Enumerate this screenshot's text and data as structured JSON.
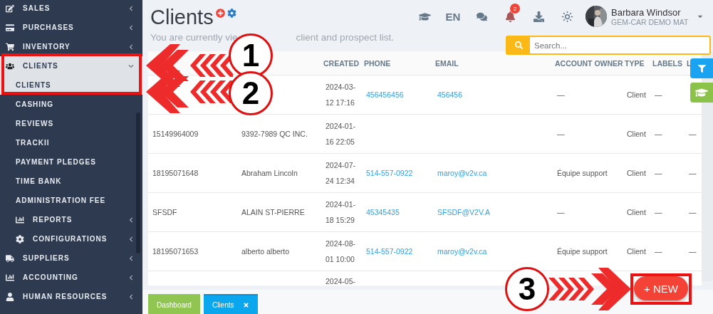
{
  "sidebar": {
    "items": [
      {
        "label": "SALES",
        "expanded": false
      },
      {
        "label": "PURCHASES",
        "expanded": false
      },
      {
        "label": "INVENTORY",
        "expanded": false
      },
      {
        "label": "CLIENTS",
        "expanded": true,
        "children": [
          {
            "label": "CLIENTS",
            "selected": true
          },
          {
            "label": "CASHING",
            "selected": false
          },
          {
            "label": "REVIEWS",
            "selected": false
          },
          {
            "label": "TRACKII",
            "selected": false
          },
          {
            "label": "PAYMENT PLEDGES",
            "selected": false
          },
          {
            "label": "TIME BANK",
            "selected": false
          },
          {
            "label": "ADMINISTRATION FEE",
            "selected": false
          },
          {
            "label": "REPORTS",
            "selected": false,
            "expanded": false
          },
          {
            "label": "CONFIGURATIONS",
            "selected": false,
            "expanded": false
          }
        ]
      },
      {
        "label": "SUPPLIERS",
        "expanded": false
      },
      {
        "label": "ACCOUNTING",
        "expanded": false
      },
      {
        "label": "HUMAN RESOURCES",
        "expanded": false
      }
    ]
  },
  "header": {
    "title": "Clients",
    "subtitle_start": "You are currently vie",
    "subtitle_end": "client and prospect list.",
    "language": "EN",
    "notifications": "2",
    "user": {
      "name": "Barbara Windsor",
      "company": "GEM-CAR DEMO MAT"
    },
    "search": {
      "placeholder": "Search..."
    }
  },
  "table": {
    "columns": [
      "",
      "",
      "CREATED",
      "PHONE",
      "EMAIL",
      "ACCOUNT OWNER",
      "TYPE",
      "LABELS",
      "L"
    ],
    "rows": [
      {
        "cells": [
          "",
          "",
          [
            "2024-03-",
            "12 17:16"
          ],
          "456456456",
          "456456",
          "—",
          "Client",
          "—",
          ""
        ]
      },
      {
        "cells": [
          "15149964009",
          "9392-7989 QC INC.",
          [
            "2024-01-",
            "16 22:05"
          ],
          "",
          "",
          "—",
          "Client",
          "—",
          "—"
        ]
      },
      {
        "cells": [
          "18195071648",
          "Abraham Lincoln",
          [
            "2024-07-",
            "24 12:34"
          ],
          "514-557-0922",
          "maroy@v2v.ca",
          "Équipe support",
          "Client",
          "—",
          "—"
        ]
      },
      {
        "cells": [
          "SFSDF",
          "ALAIN ST-PIERRE",
          [
            "2024-01-",
            "18 15:29"
          ],
          "45345435",
          "SFSDF@V2V.A",
          "—",
          "Client",
          "—",
          "—"
        ]
      },
      {
        "cells": [
          "18195071653",
          "alberto alberto",
          [
            "2024-08-",
            "01 10:00"
          ],
          "514-557-0922",
          "maroy@v2v.ca",
          "Équipe support",
          "Client",
          "—",
          "—"
        ]
      },
      {
        "cells": [
          "",
          "",
          [
            "2024-05-"
          ],
          "",
          "",
          "",
          "",
          "",
          ""
        ]
      }
    ]
  },
  "new_button": "+ NEW",
  "bottom_tabs": [
    {
      "label": "Dashboard",
      "kind": "plain",
      "selected": false
    },
    {
      "label": "Clients",
      "kind": "closable",
      "selected": true
    }
  ],
  "annotations": [
    {
      "label": "1"
    },
    {
      "label": "2"
    },
    {
      "label": "3"
    }
  ]
}
